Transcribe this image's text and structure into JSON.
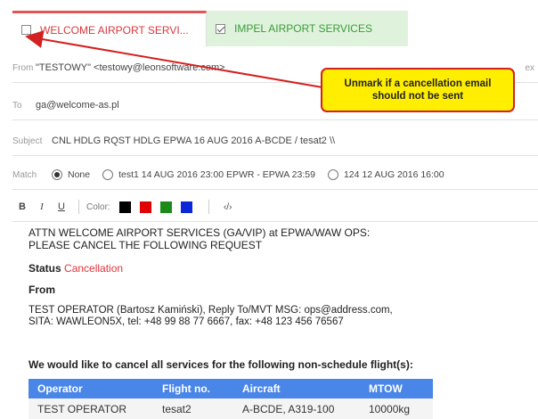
{
  "tabs": [
    {
      "label": "WELCOME AIRPORT SERVI...",
      "checked": false
    },
    {
      "label": "IMPEL AIRPORT SERVICES",
      "checked": true
    }
  ],
  "fields": {
    "from_label": "From",
    "from_value": "\"TESTOWY\" <testowy@leonsoftware.com>",
    "from_extra": "ex",
    "to_label": "To",
    "to_value": "ga@welcome-as.pl",
    "subject_label": "Subject",
    "subject_value": "CNL HDLG RQST HDLG  EPWA 16 AUG 2016  A-BCDE / tesat2 \\\\",
    "match_label": "Match",
    "match_options": [
      {
        "label": "None",
        "selected": true
      },
      {
        "label": "test1 14 AUG 2016 23:00 EPWR - EPWA 23:59",
        "selected": false
      },
      {
        "label": "124 12 AUG 2016 16:00",
        "selected": false
      }
    ]
  },
  "toolbar": {
    "bold": "B",
    "italic": "I",
    "underline": "U",
    "color_label": "Color:",
    "colors": [
      "#000000",
      "#e00000",
      "#1a8a1a",
      "#0a28d8"
    ],
    "source": "‹/›"
  },
  "message": {
    "attn_line1": "ATTN WELCOME AIRPORT SERVICES (GA/VIP) at EPWA/WAW OPS:",
    "attn_line2": "PLEASE CANCEL THE FOLLOWING REQUEST",
    "status_label": "Status",
    "status_value": "Cancellation",
    "from_heading": "From",
    "from_line1": "TEST OPERATOR (Bartosz Kamiński), Reply To/MVT MSG: ops@address.com,",
    "from_line2": "SITA: WAWLEON5X,  tel: +48 99 88 77 6667,  fax: +48 123 456 76567",
    "cancel_text": "We would like to cancel all services for the following non-schedule flight(s):"
  },
  "table": {
    "headers": [
      "Operator",
      "Flight no.",
      "Aircraft",
      "MTOW"
    ],
    "rows": [
      [
        "TEST OPERATOR",
        "tesat2",
        "A-BCDE, A319-100",
        "10000kg"
      ]
    ]
  },
  "callout": {
    "text": "Unmark if a cancellation email should not be sent"
  }
}
